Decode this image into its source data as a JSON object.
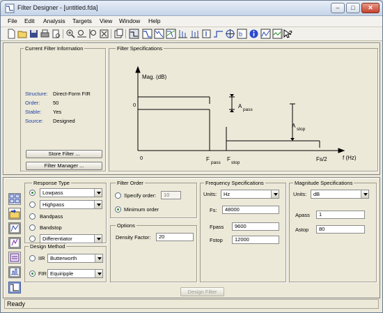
{
  "window": {
    "title": "Filter Designer - [untitled.fda]",
    "controls": [
      "–",
      "□",
      "✕"
    ]
  },
  "menu": [
    "File",
    "Edit",
    "Analysis",
    "Targets",
    "View",
    "Window",
    "Help"
  ],
  "toolbar_icons": [
    "new-icon",
    "open-icon",
    "save-icon",
    "print-icon",
    "print-preview-icon",
    "zoom-in-icon",
    "zoom-x-icon",
    "zoom-y-icon",
    "full-view-icon",
    "new-window-icon",
    "filter-specs-icon",
    "magnitude-response-icon",
    "phase-response-icon",
    "mag-phase-icon",
    "group-delay-icon",
    "phase-delay-icon",
    "impulse-response-icon",
    "step-response-icon",
    "pole-zero-icon",
    "coefficients-icon",
    "filter-info-icon",
    "round-off-noise-icon",
    "magnitude-estimate-icon",
    "whats-this-icon"
  ],
  "current_filter": {
    "title": "Current Filter Information",
    "rows": [
      {
        "label": "Structure:",
        "value": "Direct-Form FIR"
      },
      {
        "label": "Order:",
        "value": "50"
      },
      {
        "label": "Stable:",
        "value": "Yes"
      },
      {
        "label": "Source:",
        "value": "Designed"
      }
    ],
    "store_button": "Store Filter ...",
    "manager_button": "Filter Manager ..."
  },
  "filter_specs": {
    "title": "Filter Specifications",
    "y_axis_label": "Mag. (dB)",
    "zero_y": "0",
    "zero_x": "0",
    "apass_label": "A",
    "apass_sub": "pass",
    "astop_label": "A",
    "astop_sub": "stop",
    "fpass_label": "F",
    "fpass_sub": "pass",
    "fstop_label": "F",
    "fstop_sub": "stop",
    "fs2_label": "Fs/2",
    "x_axis_label": "f (Hz)"
  },
  "response_type": {
    "title": "Response Type",
    "options": [
      {
        "label": "Lowpass",
        "selected": true,
        "type": "select"
      },
      {
        "label": "Highpass",
        "selected": false,
        "type": "select"
      },
      {
        "label": "Bandpass",
        "selected": false,
        "type": "text"
      },
      {
        "label": "Bandstop",
        "selected": false,
        "type": "text"
      },
      {
        "label": "Differentiator",
        "selected": false,
        "type": "select"
      }
    ]
  },
  "design_method": {
    "title": "Design Method",
    "iir_label": "IIR",
    "iir_value": "Butterworth",
    "fir_label": "FIR",
    "fir_value": "Equiripple",
    "selected": "FIR"
  },
  "filter_order": {
    "title": "Filter Order",
    "specify_label": "Specify order:",
    "specify_value": "10",
    "minimum_label": "Minimum order",
    "selected": "Minimum order"
  },
  "options": {
    "title": "Options",
    "density_label": "Density Factor:",
    "density_value": "20"
  },
  "frequency_specs": {
    "title": "Frequency Specifications",
    "units_label": "Units:",
    "units_value": "Hz",
    "fs_label": "Fs:",
    "fs_value": "48000",
    "fpass_label": "Fpass",
    "fpass_value": "9600",
    "fstop_label": "Fstop",
    "fstop_value": "12000"
  },
  "magnitude_specs": {
    "title": "Magnitude Specifications",
    "units_label": "Units:",
    "units_value": "dB",
    "apass_label": "Apass",
    "apass_value": "1",
    "astop_label": "Astop",
    "astop_value": "80"
  },
  "design_button": "Design Filter",
  "status": "Ready",
  "colors": {
    "spec_line": "#000000",
    "title_gradient_top": "#e7eef8",
    "panel_bg": "#ece9d8",
    "label_blue": "#2040a0"
  }
}
